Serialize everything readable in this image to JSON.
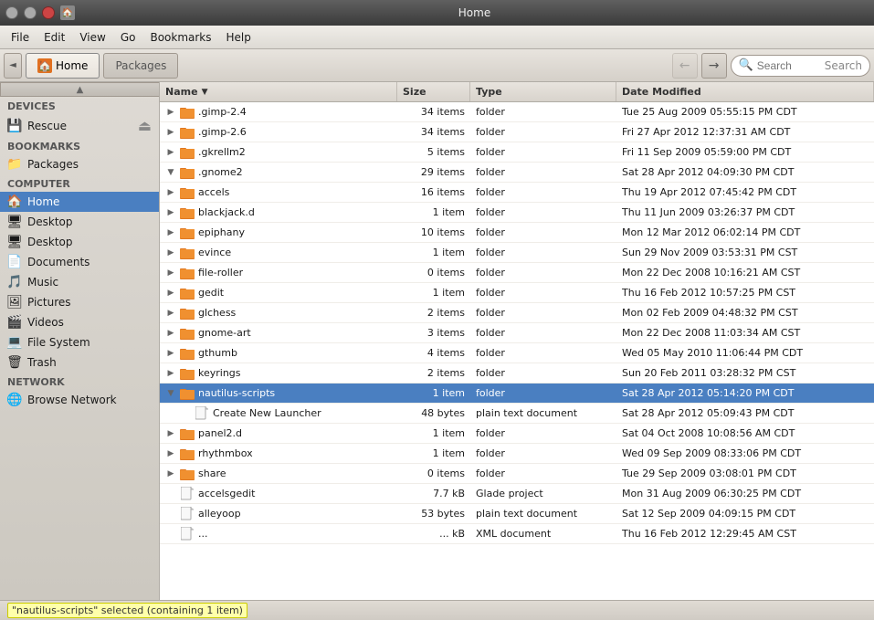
{
  "window": {
    "title": "Home",
    "close_label": "×",
    "min_label": "−",
    "max_label": "□"
  },
  "menu": {
    "items": [
      "File",
      "Edit",
      "View",
      "Go",
      "Bookmarks",
      "Help"
    ]
  },
  "toolbar": {
    "toggle_label": "◄",
    "tabs": [
      {
        "label": "Home",
        "active": true
      },
      {
        "label": "Packages",
        "active": false
      }
    ],
    "back_label": "←",
    "forward_label": "→",
    "search_label": "Search",
    "search_placeholder": "Search"
  },
  "sidebar": {
    "sections": [
      {
        "header": "Devices",
        "items": [
          {
            "label": "Rescue",
            "icon": "drive",
            "eject": true
          }
        ]
      },
      {
        "header": "Bookmarks",
        "items": [
          {
            "label": "Packages",
            "icon": "folder-orange"
          }
        ]
      },
      {
        "header": "Computer",
        "items": [
          {
            "label": "Home",
            "icon": "home",
            "active": true
          },
          {
            "label": "Desktop",
            "icon": "desktop"
          },
          {
            "label": "Desktop",
            "icon": "desktop"
          },
          {
            "label": "Documents",
            "icon": "documents"
          },
          {
            "label": "Music",
            "icon": "music"
          },
          {
            "label": "Pictures",
            "icon": "pictures"
          },
          {
            "label": "Videos",
            "icon": "videos"
          },
          {
            "label": "File System",
            "icon": "filesystem"
          },
          {
            "label": "Trash",
            "icon": "trash"
          }
        ]
      },
      {
        "header": "Network",
        "items": [
          {
            "label": "Browse Network",
            "icon": "network"
          }
        ]
      }
    ]
  },
  "columns": [
    {
      "label": "Name",
      "key": "name"
    },
    {
      "label": "Size",
      "key": "size"
    },
    {
      "label": "Type",
      "key": "type"
    },
    {
      "label": "Date Modified",
      "key": "date"
    }
  ],
  "files": [
    {
      "indent": 0,
      "expand": "collapsed",
      "name": ".gimp-2.4",
      "size": "34 items",
      "type": "folder",
      "date": "Tue 25 Aug 2009 05:55:15 PM CDT",
      "icon": "folder"
    },
    {
      "indent": 0,
      "expand": "collapsed",
      "name": ".gimp-2.6",
      "size": "34 items",
      "type": "folder",
      "date": "Fri 27 Apr 2012 12:37:31 AM CDT",
      "icon": "folder"
    },
    {
      "indent": 0,
      "expand": "collapsed",
      "name": ".gkrellm2",
      "size": "5 items",
      "type": "folder",
      "date": "Fri 11 Sep 2009 05:59:00 PM CDT",
      "icon": "folder"
    },
    {
      "indent": 0,
      "expand": "expanded",
      "name": ".gnome2",
      "size": "29 items",
      "type": "folder",
      "date": "Sat 28 Apr 2012 04:09:30 PM CDT",
      "icon": "folder"
    },
    {
      "indent": 0,
      "expand": "collapsed",
      "name": "accels",
      "size": "16 items",
      "type": "folder",
      "date": "Thu 19 Apr 2012 07:45:42 PM CDT",
      "icon": "folder"
    },
    {
      "indent": 0,
      "expand": "collapsed",
      "name": "blackjack.d",
      "size": "1 item",
      "type": "folder",
      "date": "Thu 11 Jun 2009 03:26:37 PM CDT",
      "icon": "folder"
    },
    {
      "indent": 0,
      "expand": "collapsed",
      "name": "epiphany",
      "size": "10 items",
      "type": "folder",
      "date": "Mon 12 Mar 2012 06:02:14 PM CDT",
      "icon": "folder"
    },
    {
      "indent": 0,
      "expand": "collapsed",
      "name": "evince",
      "size": "1 item",
      "type": "folder",
      "date": "Sun 29 Nov 2009 03:53:31 PM CST",
      "icon": "folder"
    },
    {
      "indent": 0,
      "expand": "collapsed",
      "name": "file-roller",
      "size": "0 items",
      "type": "folder",
      "date": "Mon 22 Dec 2008 10:16:21 AM CST",
      "icon": "folder"
    },
    {
      "indent": 0,
      "expand": "collapsed",
      "name": "gedit",
      "size": "1 item",
      "type": "folder",
      "date": "Thu 16 Feb 2012 10:57:25 PM CST",
      "icon": "folder"
    },
    {
      "indent": 0,
      "expand": "collapsed",
      "name": "glchess",
      "size": "2 items",
      "type": "folder",
      "date": "Mon 02 Feb 2009 04:48:32 PM CST",
      "icon": "folder"
    },
    {
      "indent": 0,
      "expand": "collapsed",
      "name": "gnome-art",
      "size": "3 items",
      "type": "folder",
      "date": "Mon 22 Dec 2008 11:03:34 AM CST",
      "icon": "folder"
    },
    {
      "indent": 0,
      "expand": "collapsed",
      "name": "gthumb",
      "size": "4 items",
      "type": "folder",
      "date": "Wed 05 May 2010 11:06:44 PM CDT",
      "icon": "folder"
    },
    {
      "indent": 0,
      "expand": "collapsed",
      "name": "keyrings",
      "size": "2 items",
      "type": "folder",
      "date": "Sun 20 Feb 2011 03:28:32 PM CST",
      "icon": "folder"
    },
    {
      "indent": 0,
      "expand": "expanded",
      "name": "nautilus-scripts",
      "size": "1 item",
      "type": "folder",
      "date": "Sat 28 Apr 2012 05:14:20 PM CDT",
      "icon": "folder",
      "selected": true
    },
    {
      "indent": 1,
      "expand": "none",
      "name": "Create New Launcher",
      "size": "48 bytes",
      "type": "plain text document",
      "date": "Sat 28 Apr 2012 05:09:43 PM CDT",
      "icon": "text"
    },
    {
      "indent": 0,
      "expand": "collapsed",
      "name": "panel2.d",
      "size": "1 item",
      "type": "folder",
      "date": "Sat 04 Oct 2008 10:08:56 AM CDT",
      "icon": "folder"
    },
    {
      "indent": 0,
      "expand": "collapsed",
      "name": "rhythmbox",
      "size": "1 item",
      "type": "folder",
      "date": "Wed 09 Sep 2009 08:33:06 PM CDT",
      "icon": "folder"
    },
    {
      "indent": 0,
      "expand": "collapsed",
      "name": "share",
      "size": "0 items",
      "type": "folder",
      "date": "Tue 29 Sep 2009 03:08:01 PM CDT",
      "icon": "folder"
    },
    {
      "indent": 0,
      "expand": "none",
      "name": "accelsgedit",
      "size": "7.7 kB",
      "type": "Glade project",
      "date": "Mon 31 Aug 2009 06:30:25 PM CDT",
      "icon": "text"
    },
    {
      "indent": 0,
      "expand": "none",
      "name": "alleyoop",
      "size": "53 bytes",
      "type": "plain text document",
      "date": "Sat 12 Sep 2009 04:09:15 PM CDT",
      "icon": "text"
    },
    {
      "indent": 0,
      "expand": "none",
      "name": "...",
      "size": "... kB",
      "type": "XML document",
      "date": "Thu 16 Feb 2012 12:29:45 AM CST",
      "icon": "text"
    }
  ],
  "statusbar": {
    "selected_text": "\"nautilus-scripts\" selected (containing 1 item)"
  }
}
